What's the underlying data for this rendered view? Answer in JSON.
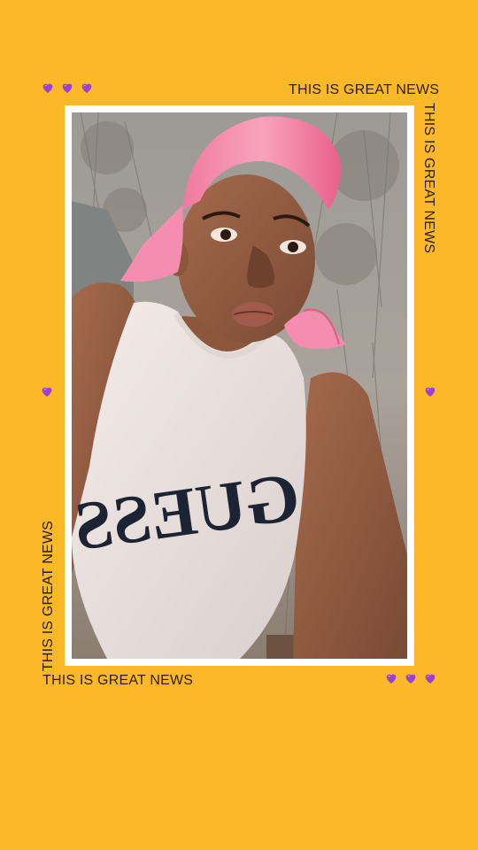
{
  "background_color": "#FBB829",
  "heart_color": "#9B3FD6",
  "captions": {
    "top_right": "THIS IS GREAT NEWS",
    "right_vertical": "THIS IS GREAT NEWS",
    "left_vertical": "THIS IS GREAT NEWS",
    "bottom_left": "THIS IS GREAT NEWS"
  },
  "photo": {
    "shirt_text": "GUESS"
  },
  "icons": {
    "heart": "purple-heart-icon"
  }
}
